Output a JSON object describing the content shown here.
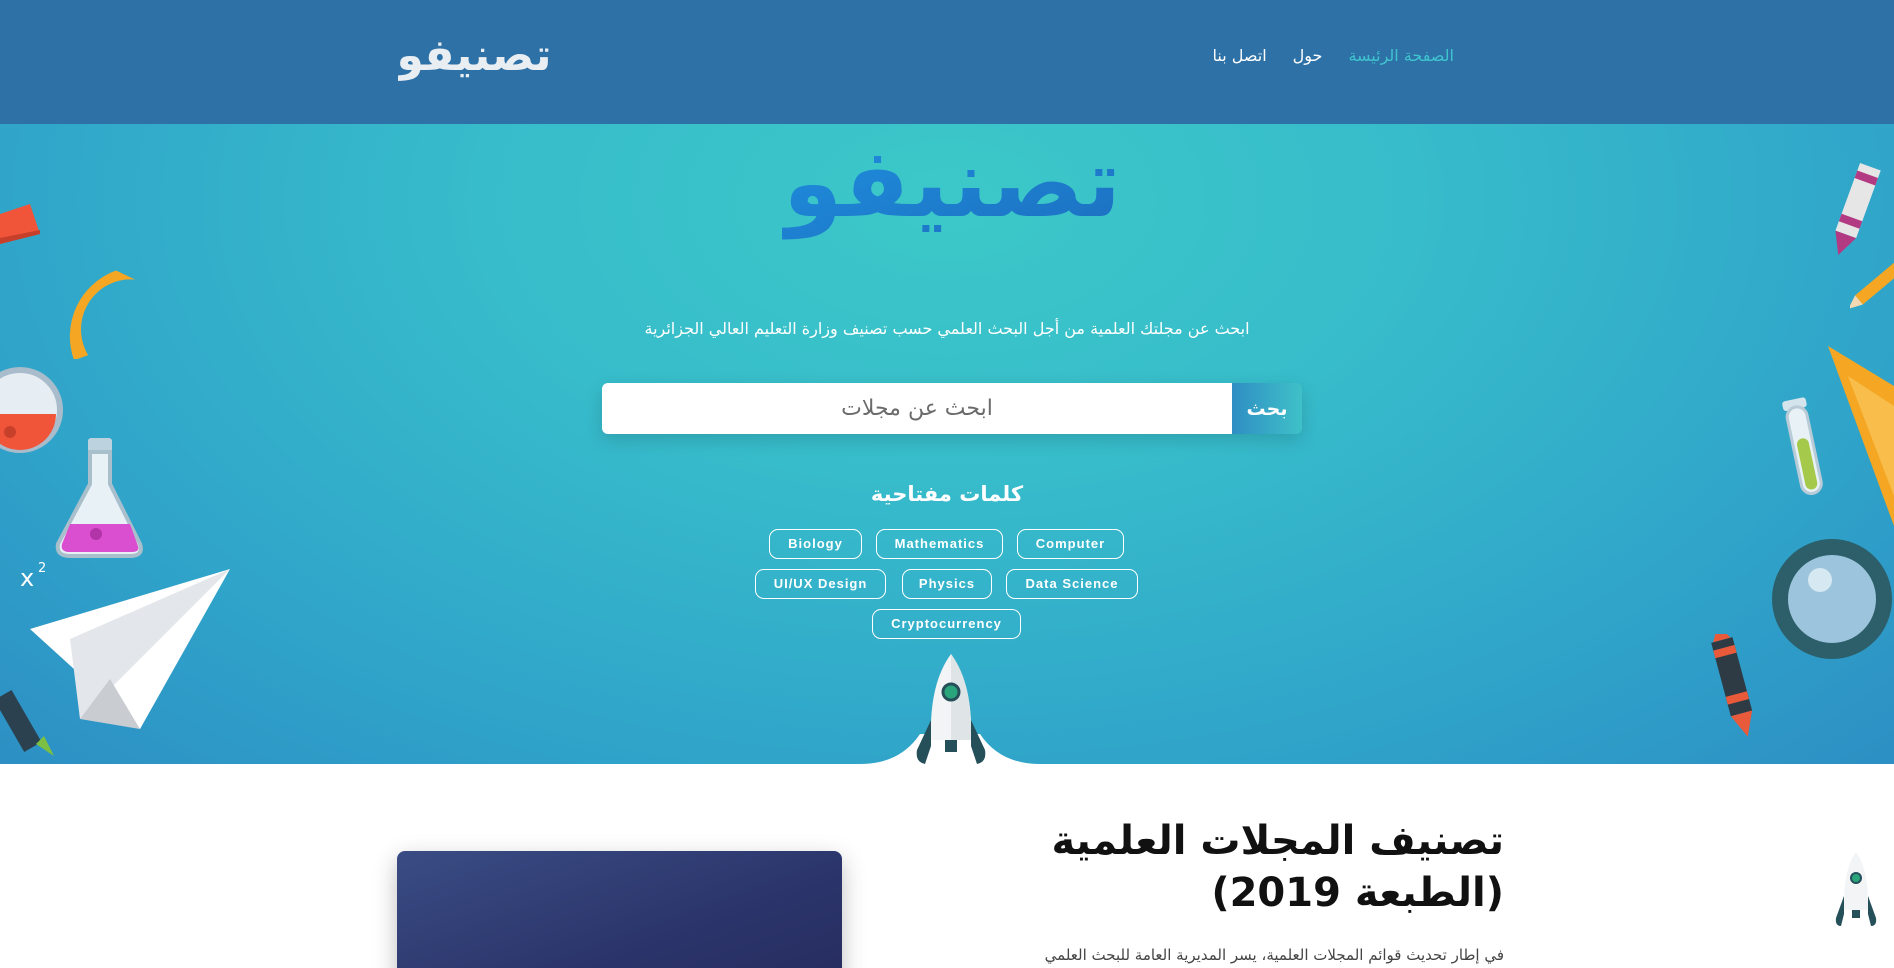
{
  "nav": {
    "logo_text": "تصنيفو",
    "links": [
      "الصفحة الرئيسة",
      "حول",
      "اتصل بنا"
    ]
  },
  "hero": {
    "logo_text": "تصنيفو",
    "tagline": "ابحث عن مجلتك العلمية من أجل البحث العلمي حسب تصنيف وزارة التعليم العالي الجزائرية",
    "search": {
      "placeholder": "ابحث عن مجلات",
      "value": "",
      "button_label": "بحث"
    },
    "keywords_title": "كلمات مفتاحية",
    "tags": [
      "Biology",
      "Mathematics",
      "Computer",
      "UI/UX Design",
      "Physics",
      "Data Science",
      "Cryptocurrency"
    ]
  },
  "content": {
    "title_line1": "تصنيف المجلات العلمية",
    "title_line2": "(الطبعة 2019)",
    "paragraph": "في إطار تحديث قوائم المجلات العلمية، يسر المديرية العامة للبحث العلمي"
  },
  "colors": {
    "navbar": "#2e71a6",
    "active_link": "#3fc4cf",
    "hero_teal": "#3cc8c8",
    "hero_blue": "#2d8fc4"
  },
  "icons": [
    "rocket-icon",
    "paper-plane-icon",
    "protractor-icon",
    "flask-icon",
    "test-tube-icon",
    "magnifier-icon",
    "crayon-icon",
    "pencil-icon",
    "eraser-icon"
  ]
}
